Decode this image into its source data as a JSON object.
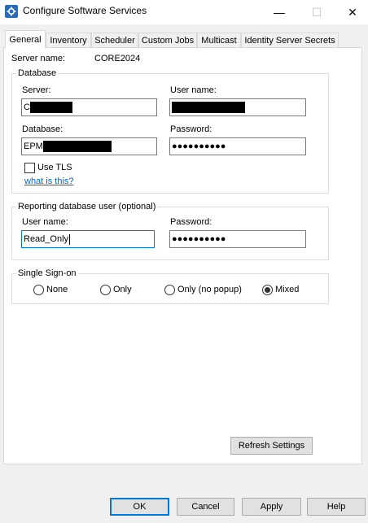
{
  "window": {
    "title": "Configure Software Services",
    "icon": "gear-icon",
    "controls": {
      "minimize": "—",
      "maximize": "☐",
      "close": "✕"
    }
  },
  "tabs": [
    {
      "label": "General",
      "active": true
    },
    {
      "label": "Inventory"
    },
    {
      "label": "Scheduler"
    },
    {
      "label": "Custom Jobs"
    },
    {
      "label": "Multicast"
    },
    {
      "label": "Identity Server Secrets"
    }
  ],
  "general": {
    "server_name_label": "Server name:",
    "server_name_value": "CORE2024",
    "database": {
      "legend": "Database",
      "server_label": "Server:",
      "server_value": "C",
      "username_label": "User name:",
      "database_label": "Database:",
      "database_value": "EPM",
      "password_label": "Password:",
      "password_value": "●●●●●●●●●●",
      "use_tls_label": "Use TLS",
      "use_tls_checked": false,
      "what_is_this": "what is this?"
    },
    "reporting": {
      "legend": "Reporting database user (optional)",
      "username_label": "User name:",
      "username_value": "Read_Only",
      "password_label": "Password:",
      "password_value": "●●●●●●●●●●"
    },
    "sso": {
      "legend": "Single Sign-on",
      "options": [
        {
          "label": "None",
          "selected": false
        },
        {
          "label": "Only",
          "selected": false
        },
        {
          "label": "Only (no popup)",
          "selected": false
        },
        {
          "label": "Mixed",
          "selected": true
        }
      ]
    },
    "refresh_label": "Refresh Settings"
  },
  "buttons": {
    "ok": "OK",
    "cancel": "Cancel",
    "apply": "Apply",
    "help": "Help"
  },
  "colors": {
    "accent": "#0078d7",
    "link": "#0066cc",
    "app_icon": "#2b6cb8"
  }
}
